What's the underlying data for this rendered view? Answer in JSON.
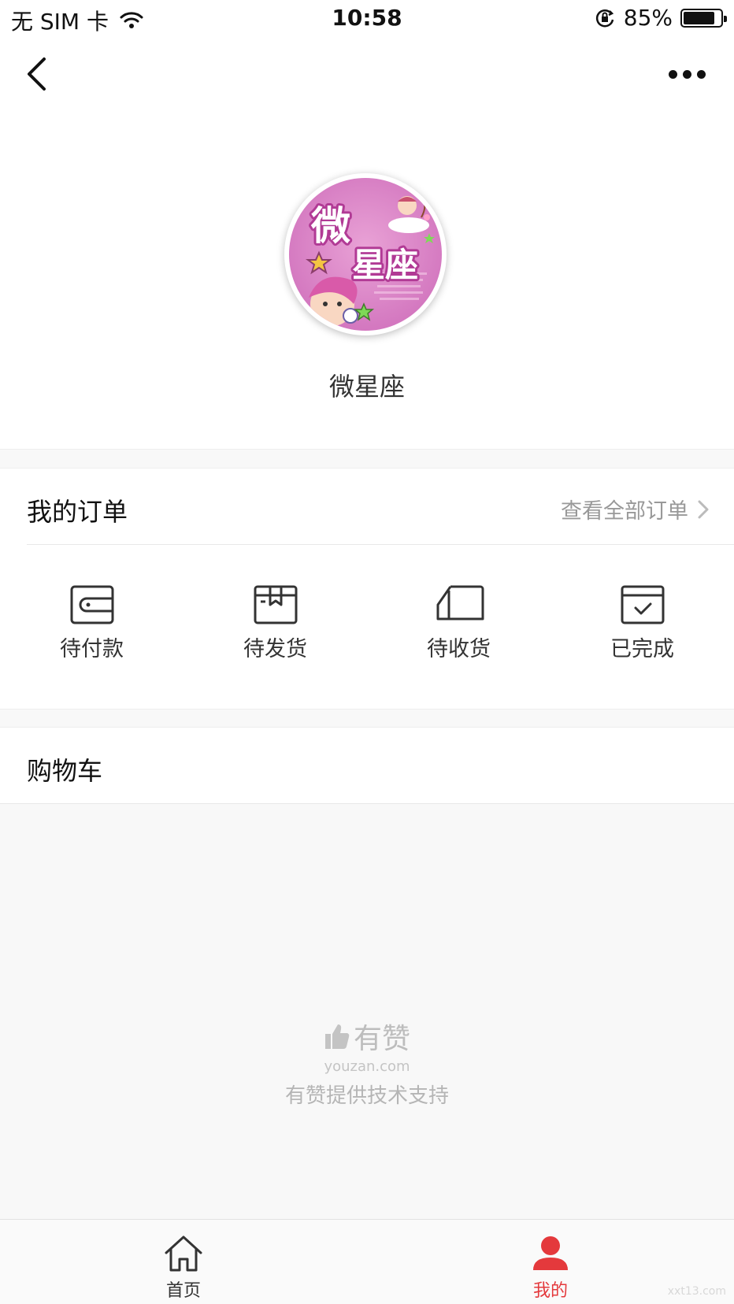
{
  "status_bar": {
    "carrier": "无 SIM 卡",
    "time": "10:58",
    "battery_percent": "85%",
    "battery_level": 0.85
  },
  "nav": {
    "back_icon": "chevron-left-icon",
    "more_icon": "ellipsis-icon"
  },
  "profile": {
    "avatar_text_1": "微",
    "avatar_text_2": "星座",
    "shop_name": "微星座"
  },
  "orders": {
    "title": "我的订单",
    "view_all": "查看全部订单",
    "items": [
      {
        "label": "待付款",
        "icon": "wallet-icon"
      },
      {
        "label": "待发货",
        "icon": "package-icon"
      },
      {
        "label": "待收货",
        "icon": "truck-icon"
      },
      {
        "label": "已完成",
        "icon": "check-box-icon"
      }
    ]
  },
  "cart": {
    "label": "购物车"
  },
  "brand": {
    "name": "有赞",
    "domain": "youzan.com",
    "support": "有赞提供技术支持"
  },
  "tabs": [
    {
      "label": "首页",
      "icon": "home-icon",
      "active": false
    },
    {
      "label": "我的",
      "icon": "user-icon",
      "active": true
    }
  ],
  "colors": {
    "accent": "#e4393c",
    "background": "#f8f8f8"
  },
  "watermark": "xxt13.com"
}
